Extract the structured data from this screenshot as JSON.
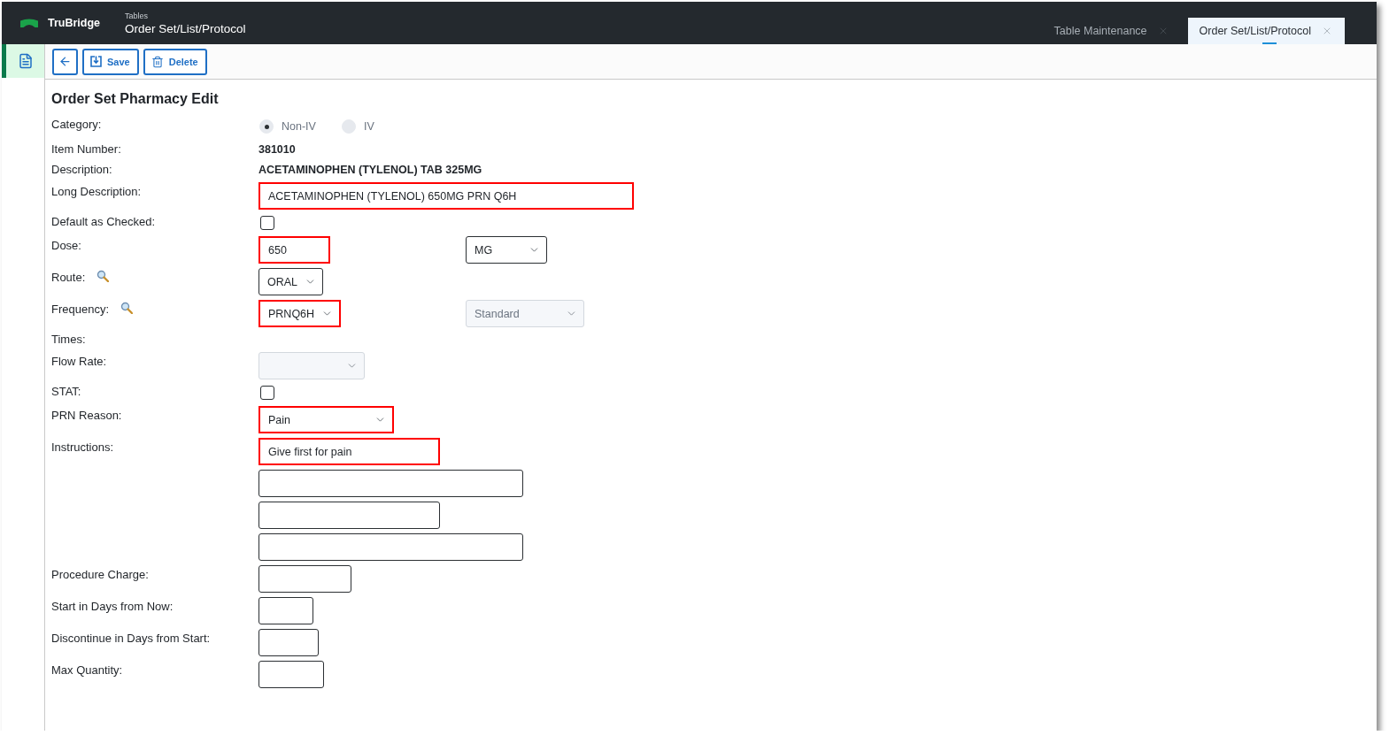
{
  "header": {
    "brand": "TruBridge",
    "section": "Tables",
    "title": "Order Set/List/Protocol"
  },
  "tabs": [
    {
      "label": "Table Maintenance",
      "selected": false
    },
    {
      "label": "Order Set/List/Protocol",
      "selected": true
    }
  ],
  "sidebar": {
    "items": [
      {
        "selected": true
      }
    ]
  },
  "toolbar": {
    "buttons": [
      {
        "kind": "back"
      },
      {
        "kind": "save",
        "label": "Save"
      },
      {
        "kind": "delete",
        "label": "Delete"
      }
    ]
  },
  "form": {
    "title": "Order Set Pharmacy Edit",
    "fields": [
      {
        "label": "Category:",
        "controls": [
          {
            "kind": "radio",
            "label": "Non-IV",
            "selected": true,
            "disabled": true
          },
          {
            "kind": "radio",
            "label": "IV",
            "selected": false,
            "disabled": true
          }
        ]
      },
      {
        "label": "Item Number:",
        "controls": [
          {
            "kind": "text",
            "value": "381010"
          }
        ]
      },
      {
        "label": "Description:",
        "controls": [
          {
            "kind": "text",
            "value": "ACETAMINOPHEN (TYLENOL) TAB 325MG"
          }
        ]
      },
      {
        "label": "Long Description:",
        "controls": [
          {
            "kind": "input",
            "value": "ACETAMINOPHEN (TYLENOL) 650MG PRN Q6H",
            "highlighted": true
          }
        ]
      },
      {
        "label": "Default as Checked:",
        "controls": [
          {
            "kind": "checkbox",
            "checked": false
          }
        ]
      },
      {
        "label": "Dose:",
        "controls": [
          {
            "kind": "input",
            "value": "650",
            "highlighted": true
          },
          {
            "kind": "select",
            "value": "MG",
            "highlighted": false
          }
        ]
      },
      {
        "label": "Route:",
        "lookup": true,
        "controls": [
          {
            "kind": "select",
            "value": "ORAL",
            "highlighted": false
          }
        ]
      },
      {
        "label": "Frequency:",
        "lookup": true,
        "controls": [
          {
            "kind": "select",
            "value": "PRNQ6H",
            "highlighted": true
          },
          {
            "kind": "select",
            "value": "Standard",
            "disabled": true
          }
        ]
      },
      {
        "label": "Times:"
      },
      {
        "label": "Flow Rate:",
        "controls": [
          {
            "kind": "select",
            "disabled": true
          }
        ]
      },
      {
        "label": "STAT:",
        "controls": [
          {
            "kind": "checkbox",
            "checked": false
          }
        ]
      },
      {
        "label": "PRN Reason:",
        "controls": [
          {
            "kind": "select",
            "value": "Pain",
            "highlighted": true
          }
        ]
      },
      {
        "label": "Instructions:",
        "lines": [
          {
            "kind": "input",
            "value": "Give first for pain",
            "highlighted": true
          },
          {
            "kind": "input",
            "highlighted": false
          },
          {
            "kind": "input",
            "highlighted": false
          },
          {
            "kind": "input",
            "highlighted": false
          }
        ]
      },
      {
        "label": "Procedure Charge:",
        "controls": [
          {
            "kind": "input",
            "highlighted": false
          }
        ]
      },
      {
        "label": "Start in Days from Now:",
        "controls": [
          {
            "kind": "input",
            "highlighted": false
          }
        ]
      },
      {
        "label": "Discontinue in Days from Start:",
        "controls": [
          {
            "kind": "input",
            "highlighted": false
          }
        ]
      },
      {
        "label": "Max Quantity:",
        "controls": [
          {
            "kind": "input",
            "highlighted": false
          }
        ]
      }
    ]
  }
}
